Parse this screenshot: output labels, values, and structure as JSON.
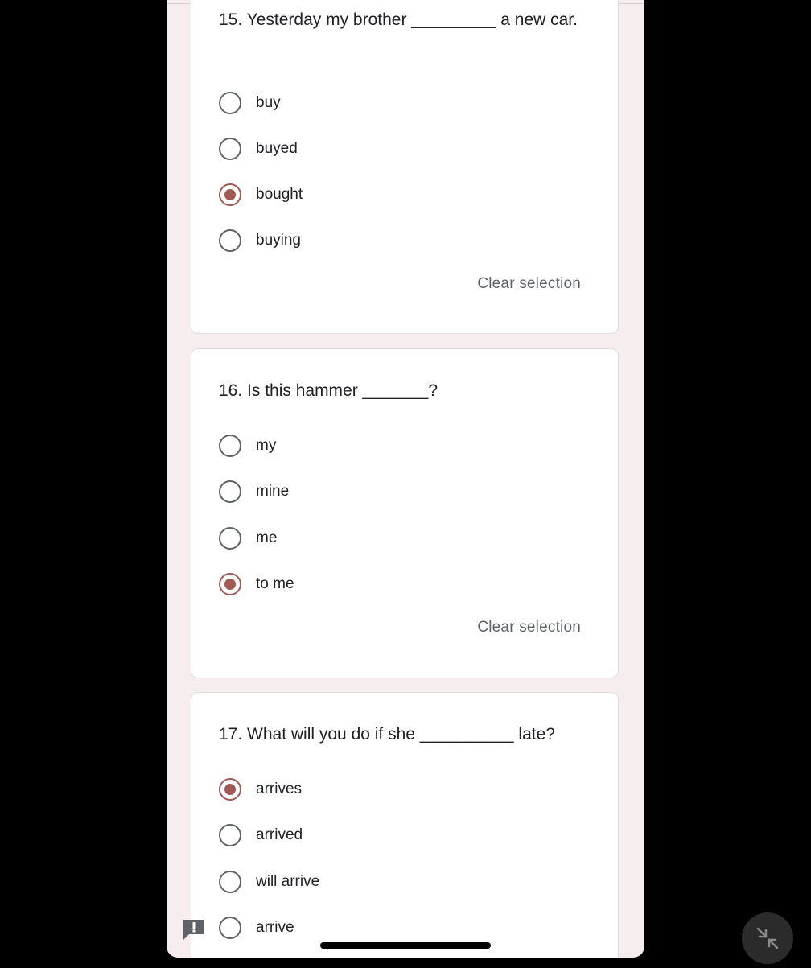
{
  "colors": {
    "page_background": "#f6eeee",
    "card_background": "#ffffff",
    "accent": "#a45a54",
    "text_primary": "#202124",
    "text_secondary": "#5f6368"
  },
  "questions": [
    {
      "title": "15. Yesterday my brother _________ a new car.",
      "options": [
        "buy",
        "buyed",
        "bought",
        "buying"
      ],
      "selected": "bought",
      "clear_label": "Clear selection"
    },
    {
      "title": "16. Is this hammer _______?",
      "options": [
        "my",
        "mine",
        "me",
        "to me"
      ],
      "selected": "to me",
      "clear_label": "Clear selection"
    },
    {
      "title": "17. What will you do if she __________ late?",
      "options": [
        "arrives",
        "arrived",
        "will arrive",
        "arrive"
      ],
      "selected": "arrives"
    }
  ],
  "icons": {
    "feedback": "feedback-icon",
    "minimize": "minimize-icon"
  }
}
